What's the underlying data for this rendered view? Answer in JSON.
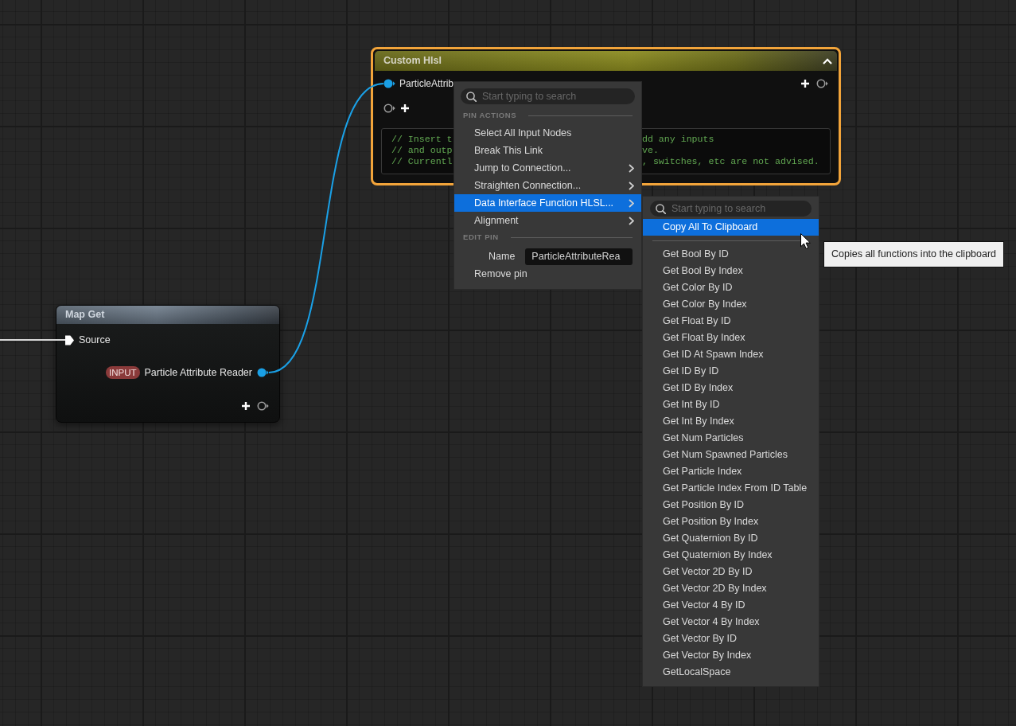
{
  "nodes": [
    {
      "kind": "custom_hlsl",
      "title": "Custom Hlsl",
      "selected": true,
      "input_pin": {
        "label": "ParticleAttrib",
        "connected": true
      },
      "code_lines": [
        {
          "left": "// Insert t",
          "right": "dd any inputs"
        },
        {
          "left": "// and outp",
          "right": "ve."
        },
        {
          "left": "// Currentl",
          "right": ", switches, etc are not advised."
        }
      ]
    },
    {
      "kind": "map_get",
      "title": "Map Get",
      "selected": false,
      "input_pin": {
        "label": "Source",
        "connected": true
      },
      "output_pin": {
        "tag": "INPUT",
        "label": "Particle Attribute Reader",
        "connected": true
      }
    }
  ],
  "context_menu": {
    "search": {
      "placeholder": "Start typing to search"
    },
    "sections": [
      {
        "header": "PIN ACTIONS",
        "items": [
          {
            "kind": "action",
            "label": "Select All Input Nodes",
            "submenu": false,
            "selected": false
          },
          {
            "kind": "action",
            "label": "Break This Link",
            "submenu": false,
            "selected": false
          },
          {
            "kind": "action",
            "label": "Jump to Connection...",
            "submenu": true,
            "selected": false
          },
          {
            "kind": "action",
            "label": "Straighten Connection...",
            "submenu": true,
            "selected": false
          },
          {
            "kind": "action",
            "label": "Data Interface Function HLSL...",
            "submenu": true,
            "selected": true
          },
          {
            "kind": "action",
            "label": "Alignment",
            "submenu": true,
            "selected": false
          }
        ]
      },
      {
        "header": "EDIT PIN",
        "items": [
          {
            "kind": "field",
            "label": "Name",
            "value": "ParticleAttributeRea",
            "selected": false
          },
          {
            "kind": "action",
            "label": "Remove pin",
            "submenu": false,
            "selected": false
          }
        ]
      }
    ]
  },
  "submenu": {
    "search": {
      "placeholder": "Start typing to search"
    },
    "actions": [
      {
        "label": "Copy All To Clipboard",
        "selected": true
      }
    ],
    "functions": [
      {
        "label": "Get Bool By ID",
        "selected": false
      },
      {
        "label": "Get Bool By Index",
        "selected": false
      },
      {
        "label": "Get Color By ID",
        "selected": false
      },
      {
        "label": "Get Color By Index",
        "selected": false
      },
      {
        "label": "Get Float By ID",
        "selected": false
      },
      {
        "label": "Get Float By Index",
        "selected": false
      },
      {
        "label": "Get ID At Spawn Index",
        "selected": false
      },
      {
        "label": "Get ID By ID",
        "selected": false
      },
      {
        "label": "Get ID By Index",
        "selected": false
      },
      {
        "label": "Get Int By ID",
        "selected": false
      },
      {
        "label": "Get Int By Index",
        "selected": false
      },
      {
        "label": "Get Num Particles",
        "selected": false
      },
      {
        "label": "Get Num Spawned Particles",
        "selected": false
      },
      {
        "label": "Get Particle Index",
        "selected": false
      },
      {
        "label": "Get Particle Index From ID Table",
        "selected": false
      },
      {
        "label": "Get Position By ID",
        "selected": false
      },
      {
        "label": "Get Position By Index",
        "selected": false
      },
      {
        "label": "Get Quaternion By ID",
        "selected": false
      },
      {
        "label": "Get Quaternion By Index",
        "selected": false
      },
      {
        "label": "Get Vector 2D By ID",
        "selected": false
      },
      {
        "label": "Get Vector 2D By Index",
        "selected": false
      },
      {
        "label": "Get Vector 4 By ID",
        "selected": false
      },
      {
        "label": "Get Vector 4 By Index",
        "selected": false
      },
      {
        "label": "Get Vector By ID",
        "selected": false
      },
      {
        "label": "Get Vector By Index",
        "selected": false
      },
      {
        "label": "GetLocalSpace",
        "selected": false
      }
    ]
  },
  "tooltip": {
    "text": "Copies all functions into the clipboard"
  }
}
